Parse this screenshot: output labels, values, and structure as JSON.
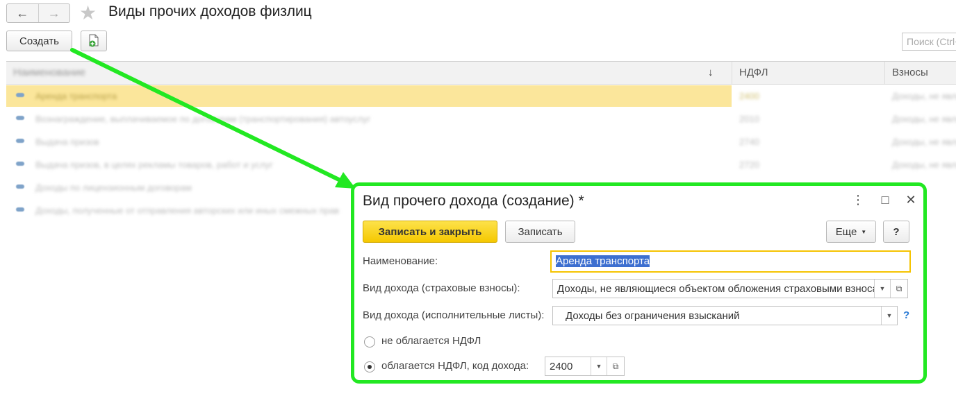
{
  "window": {
    "title": "Виды прочих доходов физлиц",
    "back_icon": "←",
    "forward_icon": "→",
    "favorite_icon": "★"
  },
  "toolbar": {
    "create_label": "Создать",
    "add_copy_icon": "add-copy-icon",
    "search_placeholder": "Поиск (Ctrl+F)"
  },
  "list": {
    "columns": [
      "Наименование",
      "НДФЛ",
      "Взносы"
    ],
    "sort_indicator": "↓",
    "rows": [
      {
        "name": "Аренда транспорта",
        "ndfl": "2400",
        "contrib": "Доходы, не являющиеся",
        "selected": true
      },
      {
        "name": "Вознаграждение, выплачиваемое по договорам (транспортирования) автоуслуг",
        "ndfl": "2010",
        "contrib": "Доходы, не являющиеся",
        "selected": false
      },
      {
        "name": "Выдача призов",
        "ndfl": "2740",
        "contrib": "Доходы, не являющиеся",
        "selected": false
      },
      {
        "name": "Выдача призов, в целях рекламы товаров, работ и услуг",
        "ndfl": "2720",
        "contrib": "Доходы, не являющиеся",
        "selected": false
      },
      {
        "name": "Доходы по лицензионным договорам",
        "ndfl": "",
        "contrib": "",
        "selected": false
      },
      {
        "name": "Доходы, полученные от отправления авторских или иных смежных прав",
        "ndfl": "",
        "contrib": "",
        "selected": false
      }
    ]
  },
  "dialog": {
    "title": "Вид прочего дохода (создание) *",
    "more_icon": "⋮",
    "maximize_icon": "□",
    "close_icon": "✕",
    "save_close_label": "Записать и закрыть",
    "save_label": "Записать",
    "more_label": "Еще",
    "help_label": "?",
    "fields": {
      "name_label": "Наименование:",
      "name_value": "Аренда транспорта",
      "insurance_label": "Вид дохода (страховые взносы):",
      "insurance_value": "Доходы, не являющиеся объектом обложения страховыми взносами",
      "writs_label": "Вид дохода (исполнительные листы):",
      "writs_value": "Доходы без ограничения взысканий",
      "writs_help": "?"
    },
    "radios": {
      "not_taxed_label": "не облагается НДФЛ",
      "taxed_label": "облагается НДФЛ, код дохода:",
      "selected": "taxed",
      "income_code": "2400"
    }
  },
  "colors": {
    "highlight_border": "#22e822",
    "primary_button": "#f5c800",
    "selected_row": "#fbe69b",
    "focus_border": "#f5c300"
  }
}
